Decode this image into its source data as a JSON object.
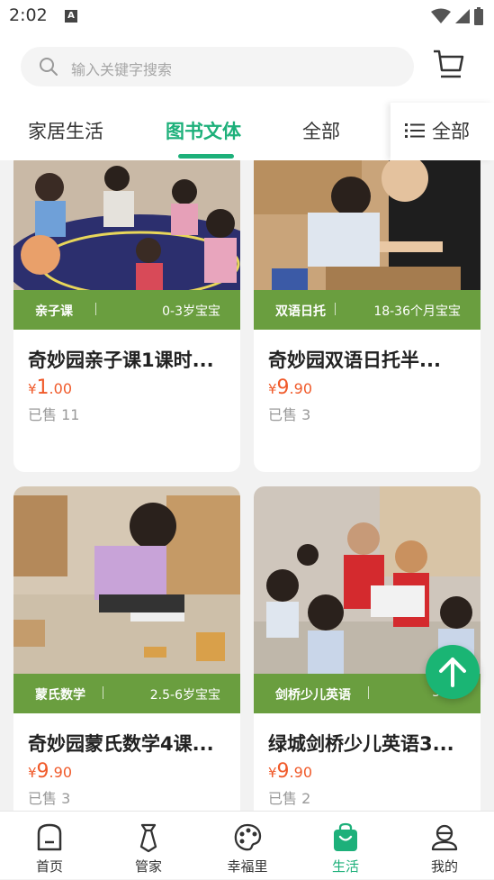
{
  "status": {
    "time": "2:02",
    "notif_icon": "A"
  },
  "search": {
    "placeholder": "输入关键字搜索"
  },
  "tabs": [
    {
      "label": "家居生活"
    },
    {
      "label": "图书文体"
    },
    {
      "label": "全部"
    }
  ],
  "tab_all": {
    "label": "全部"
  },
  "cards": [
    {
      "tag": "亲子课",
      "age": "0-3岁宝宝",
      "title": "奇妙园亲子课1课时...",
      "currency": "¥",
      "price_int": "1",
      "price_dec": ".00",
      "sold": "已售 11"
    },
    {
      "tag": "双语日托",
      "age": "18-36个月宝宝",
      "title": "奇妙园双语日托半...",
      "currency": "¥",
      "price_int": "9",
      "price_dec": ".90",
      "sold": "已售 3"
    },
    {
      "tag": "蒙氏数学",
      "age": "2.5-6岁宝宝",
      "title": "奇妙园蒙氏数学4课...",
      "currency": "¥",
      "price_int": "9",
      "price_dec": ".90",
      "sold": "已售 3"
    },
    {
      "tag": "剑桥少儿英语",
      "age": "3-12",
      "title": "绿城剑桥少儿英语3...",
      "currency": "¥",
      "price_int": "9",
      "price_dec": ".90",
      "sold": "已售 2"
    }
  ],
  "nav": [
    {
      "label": "首页"
    },
    {
      "label": "管家"
    },
    {
      "label": "幸福里"
    },
    {
      "label": "生活"
    },
    {
      "label": "我的"
    }
  ],
  "colors": {
    "accent": "#1db07a",
    "tag_bar": "#6a9e3f",
    "price": "#f05a2a"
  }
}
